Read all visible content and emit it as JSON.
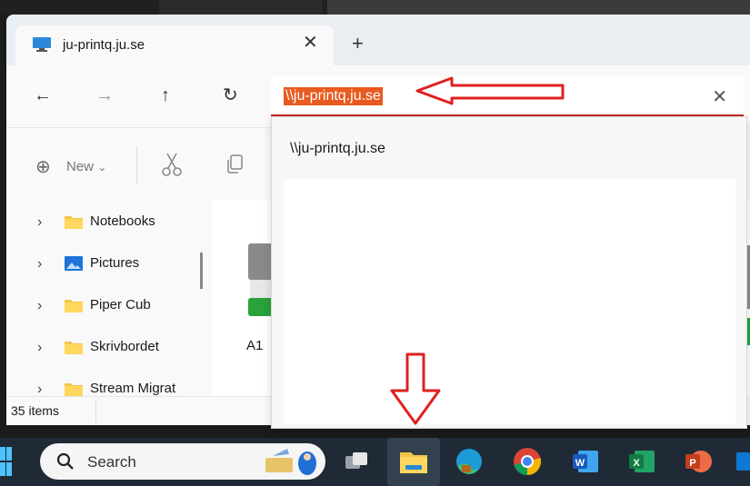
{
  "window": {
    "tab_title": "ju-printq.ju.se",
    "tab_close": "✕",
    "new_tab": "+"
  },
  "navbar": {
    "back": "←",
    "forward": "→",
    "up": "↑",
    "refresh": "↻"
  },
  "address": {
    "value": "\\\\ju-printq.ju.se",
    "clear": "✕"
  },
  "commandbar": {
    "new_label": "New",
    "new_chevron": "⌄",
    "new_icon": "⊕"
  },
  "navpane": {
    "items": [
      {
        "label": "Notebooks",
        "icon": "folder-icon"
      },
      {
        "label": "Pictures",
        "icon": "pictures-icon"
      },
      {
        "label": "Piper Cub",
        "icon": "folder-icon"
      },
      {
        "label": "Skrivbordet",
        "icon": "folder-icon"
      },
      {
        "label": "Stream Migrat",
        "icon": "folder-icon"
      }
    ],
    "chevron": "›"
  },
  "content": {
    "file_label": "A1"
  },
  "statusbar": {
    "item_count": "35 items"
  },
  "dropdown": {
    "suggestion": "\\\\ju-printq.ju.se"
  },
  "taskbar": {
    "search_label": "Search",
    "apps": [
      "task-view-icon",
      "file-explorer-icon",
      "edge-icon",
      "teams-icon",
      "chrome-icon",
      "word-icon",
      "excel-icon",
      "powerpoint-icon"
    ]
  },
  "colors": {
    "selection": "#e85a1f",
    "annotation": "#e02020",
    "taskbar": "#1f2a36"
  }
}
